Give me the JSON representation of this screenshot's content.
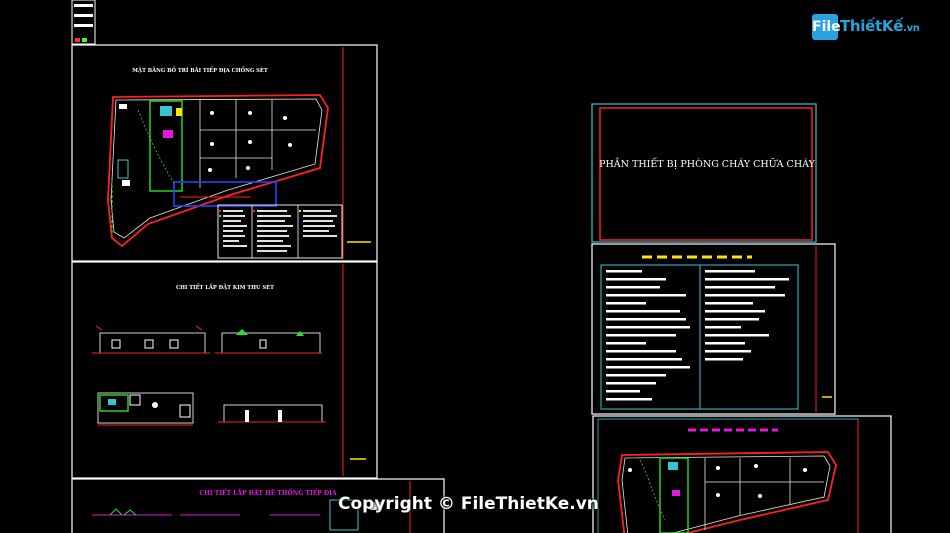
{
  "sheets": {
    "grounding_plan_title": "MẶT BẰNG BỐ TRÍ BÃI TIẾP ĐỊA CHỐNG SÉT",
    "lightning_rod_detail_title": "CHI TIẾT LẮP ĐẶT KIM THU SÉT",
    "grounding_system_detail_title": "CHI TIẾT LẮP ĐẶT HỆ THỐNG TIẾP ĐỊA",
    "fire_equipment_title": "PHẦN THIẾT BỊ PHÒNG CHÁY CHỮA CHÁY"
  },
  "watermark": {
    "brand_prefix": "File",
    "brand_name": "ThiếtKế",
    "brand_suffix": ".vn",
    "copyright_text": "Copyright © FileThietKe.vn"
  },
  "colors": {
    "background": "#000000",
    "frame_line": "#ffffff",
    "border_red": "#ff2020",
    "cyan": "#33c7d6",
    "magenta": "#e019e0",
    "yellow": "#ffe600",
    "green": "#27e227",
    "blue": "#2244ff",
    "brand_blue": "#29a3df"
  },
  "icons": [
    "plan-drawing-icon",
    "logo-badge-icon"
  ]
}
